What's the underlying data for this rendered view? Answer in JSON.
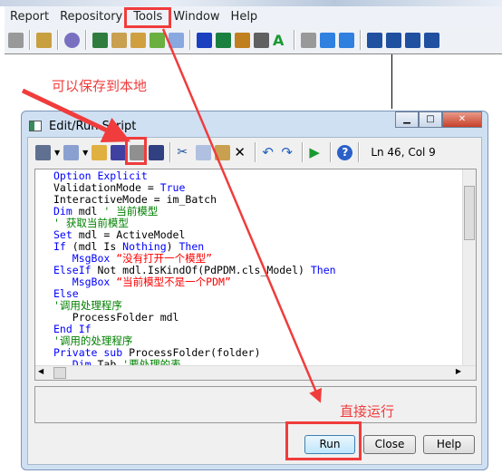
{
  "menubar": {
    "items": [
      "Report",
      "Repository",
      "Tools",
      "Window",
      "Help"
    ]
  },
  "dialog": {
    "title": "Edit/Run Script",
    "cursor_position": "Ln 46, Col 9",
    "code_lines": [
      [
        [
          "kw",
          "Option Explicit"
        ]
      ],
      [
        [
          "",
          "ValidationMode = "
        ],
        [
          "kw",
          "True"
        ]
      ],
      [
        [
          "",
          "InteractiveMode = im_Batch"
        ]
      ],
      [
        [
          "kw",
          "Dim"
        ],
        [
          "",
          " mdl "
        ],
        [
          "cm",
          "' 当前模型"
        ]
      ],
      [
        [
          "cm",
          "' 获取当前模型"
        ]
      ],
      [
        [
          "kw",
          "Set"
        ],
        [
          "",
          " mdl = ActiveModel"
        ]
      ],
      [
        [
          "kw",
          "If"
        ],
        [
          "",
          " (mdl Is "
        ],
        [
          "kw",
          "Nothing"
        ],
        [
          "",
          ") "
        ],
        [
          "kw",
          "Then"
        ]
      ],
      [
        [
          "",
          "   "
        ],
        [
          "kw",
          "MsgBox"
        ],
        [
          "st",
          " “没有打开一个模型”"
        ]
      ],
      [
        [
          "kw",
          "ElseIf"
        ],
        [
          "",
          " Not mdl.IsKindOf(PdPDM.cls_Model) "
        ],
        [
          "kw",
          "Then"
        ]
      ],
      [
        [
          "",
          "   "
        ],
        [
          "kw",
          "MsgBox"
        ],
        [
          "st",
          " “当前模型不是一个PDM”"
        ]
      ],
      [
        [
          "kw",
          "Else"
        ]
      ],
      [
        [
          "cm",
          "'调用处理程序"
        ]
      ],
      [
        [
          "",
          "   ProcessFolder mdl"
        ]
      ],
      [
        [
          "kw",
          "End If"
        ]
      ],
      [
        [
          "cm",
          "'调用的处理程序"
        ]
      ],
      [
        [
          "kw",
          "Private sub"
        ],
        [
          "",
          " ProcessFolder(folder)"
        ]
      ],
      [
        [
          "",
          "   "
        ],
        [
          "kw",
          "Dim"
        ],
        [
          "",
          " Tab "
        ],
        [
          "cm",
          "'要处理的表"
        ]
      ]
    ],
    "buttons": {
      "run": "Run",
      "close": "Close",
      "help": "Help"
    }
  },
  "annotations": {
    "save_note": "可以保存到本地",
    "run_note": "直接运行",
    "color": "#f03c3c"
  }
}
